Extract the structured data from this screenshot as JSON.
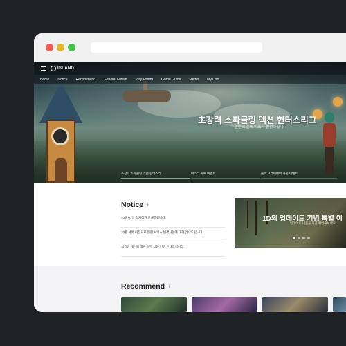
{
  "site": {
    "logo_text": "ISLAND",
    "nav": [
      "Home",
      "Notice",
      "Recommend",
      "General Forum",
      "Play Forum",
      "Game Guide",
      "Media",
      "My Lists"
    ]
  },
  "hero": {
    "title": "초강력 스파클링 액션 헌터스리그",
    "subtitle": "만반의 준비 마스터 활성화됩니다",
    "tabs": [
      "초강력 스파클링 액션 헌터스리그",
      "마스터 회복 이벤트",
      "블랙 프라이데이 카운 이벤트"
    ]
  },
  "notice": {
    "title": "Notice",
    "plus": "+",
    "items": [
      "10월 01일 정기점검 안내드립니다.",
      "10월 서버 이전으로 인한 서비스 변경사항에 대해 안내드립니다.",
      "시스템 개선에 따른 일부 상품 변경 안내드립니다."
    ]
  },
  "banner": {
    "title": "1D의 업데이트 기념 특별 이",
    "subtitle": "업데이트 내용을 지금 확인해보세요"
  },
  "recommend": {
    "title": "Recommend",
    "plus": "+"
  },
  "colors": {
    "page_bg": "#1f2326",
    "chrome": "#f1f1f1",
    "close": "#ec5b53",
    "minimize": "#e3b32b",
    "maximize": "#43c14b"
  }
}
